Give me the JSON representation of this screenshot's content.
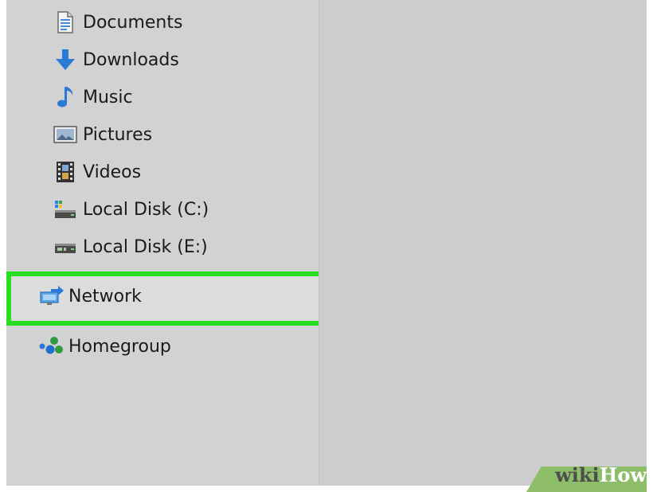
{
  "nav": {
    "items": [
      {
        "label": "Documents",
        "icon": "documents-icon"
      },
      {
        "label": "Downloads",
        "icon": "downloads-icon"
      },
      {
        "label": "Music",
        "icon": "music-icon"
      },
      {
        "label": "Pictures",
        "icon": "pictures-icon"
      },
      {
        "label": "Videos",
        "icon": "videos-icon"
      },
      {
        "label": "Local Disk (C:)",
        "icon": "local-disk-c-icon"
      },
      {
        "label": "Local Disk (E:)",
        "icon": "local-disk-e-icon"
      }
    ],
    "network": {
      "label": "Network",
      "icon": "network-icon",
      "highlighted": true
    },
    "homegroup": {
      "label": "Homegroup",
      "icon": "homegroup-icon"
    }
  },
  "colors": {
    "highlight": "#26e01f",
    "pane_background": "#d2d2d2",
    "accent_blue": "#2b7bd6"
  },
  "watermark": {
    "prefix": "wiki",
    "suffix": "How"
  }
}
